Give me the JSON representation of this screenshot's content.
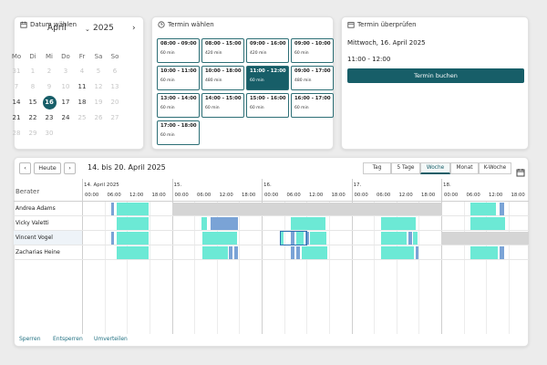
{
  "date_card": {
    "title": "Datum wählen",
    "month": "April",
    "year": "2025",
    "weekdays": [
      "Mo",
      "Di",
      "Mi",
      "Do",
      "Fr",
      "Sa",
      "So"
    ],
    "weeks": [
      [
        {
          "d": "31",
          "m": true
        },
        {
          "d": "1",
          "m": true
        },
        {
          "d": "2",
          "m": true
        },
        {
          "d": "3",
          "m": true
        },
        {
          "d": "4",
          "m": true
        },
        {
          "d": "5",
          "m": true
        },
        {
          "d": "6",
          "m": true
        }
      ],
      [
        {
          "d": "7",
          "m": true
        },
        {
          "d": "8",
          "m": true
        },
        {
          "d": "9",
          "m": true
        },
        {
          "d": "10",
          "m": true
        },
        {
          "d": "11",
          "m": false
        },
        {
          "d": "12",
          "m": true
        },
        {
          "d": "13",
          "m": true
        }
      ],
      [
        {
          "d": "14",
          "m": false
        },
        {
          "d": "15",
          "m": false
        },
        {
          "d": "16",
          "m": false,
          "sel": true
        },
        {
          "d": "17",
          "m": false
        },
        {
          "d": "18",
          "m": false
        },
        {
          "d": "19",
          "m": true
        },
        {
          "d": "20",
          "m": true
        }
      ],
      [
        {
          "d": "21",
          "m": false
        },
        {
          "d": "22",
          "m": false
        },
        {
          "d": "23",
          "m": false
        },
        {
          "d": "24",
          "m": false
        },
        {
          "d": "25",
          "m": true
        },
        {
          "d": "26",
          "m": true
        },
        {
          "d": "27",
          "m": true
        }
      ],
      [
        {
          "d": "28",
          "m": true
        },
        {
          "d": "29",
          "m": true
        },
        {
          "d": "30",
          "m": true
        }
      ]
    ]
  },
  "slot_card": {
    "title": "Termin wählen",
    "slots": [
      {
        "time": "08:00 - 09:00",
        "dur": "60 min"
      },
      {
        "time": "08:00 - 15:00",
        "dur": "420 min"
      },
      {
        "time": "09:00 - 16:00",
        "dur": "420 min"
      },
      {
        "time": "09:00 - 10:00",
        "dur": "60 min"
      },
      {
        "time": "10:00 - 11:00",
        "dur": "60 min"
      },
      {
        "time": "10:00 - 18:00",
        "dur": "480 min"
      },
      {
        "time": "11:00 - 12:00",
        "dur": "60 min",
        "selected": true
      },
      {
        "time": "09:00 - 17:00",
        "dur": "480 min"
      },
      {
        "time": "13:00 - 14:00",
        "dur": "60 min"
      },
      {
        "time": "14:00 - 15:00",
        "dur": "60 min"
      },
      {
        "time": "15:00 - 16:00",
        "dur": "60 min"
      },
      {
        "time": "16:00 - 17:00",
        "dur": "60 min"
      },
      {
        "time": "17:00 - 18:00",
        "dur": "60 min"
      }
    ]
  },
  "review_card": {
    "title": "Termin überprüfen",
    "date": "Mittwoch, 16. April 2025",
    "time": "11:00 - 12:00",
    "button": "Termin buchen"
  },
  "scheduler": {
    "today_label": "Heute",
    "range_label": "14. bis 20. April 2025",
    "views": [
      "Tag",
      "5 Tage",
      "Woche",
      "Monat",
      "K-Woche"
    ],
    "active_view": "Woche",
    "resource_header": "Berater",
    "days": [
      "14. April 2025",
      "15.",
      "16.",
      "17.",
      "18."
    ],
    "hours": [
      "00:00",
      "06:00",
      "12:00",
      "18:00"
    ],
    "advisors": [
      "Andrea Adams",
      "Vicky Valetti",
      "Vincent Vogel",
      "Zacharias Heine"
    ],
    "actions": [
      "Sperren",
      "Entsperren",
      "Umverteilen"
    ]
  },
  "colors": {
    "accent": "#175e68",
    "available": "#6ce9d5",
    "booked": "#7aa3d6",
    "blocked": "#d5d5d5"
  }
}
